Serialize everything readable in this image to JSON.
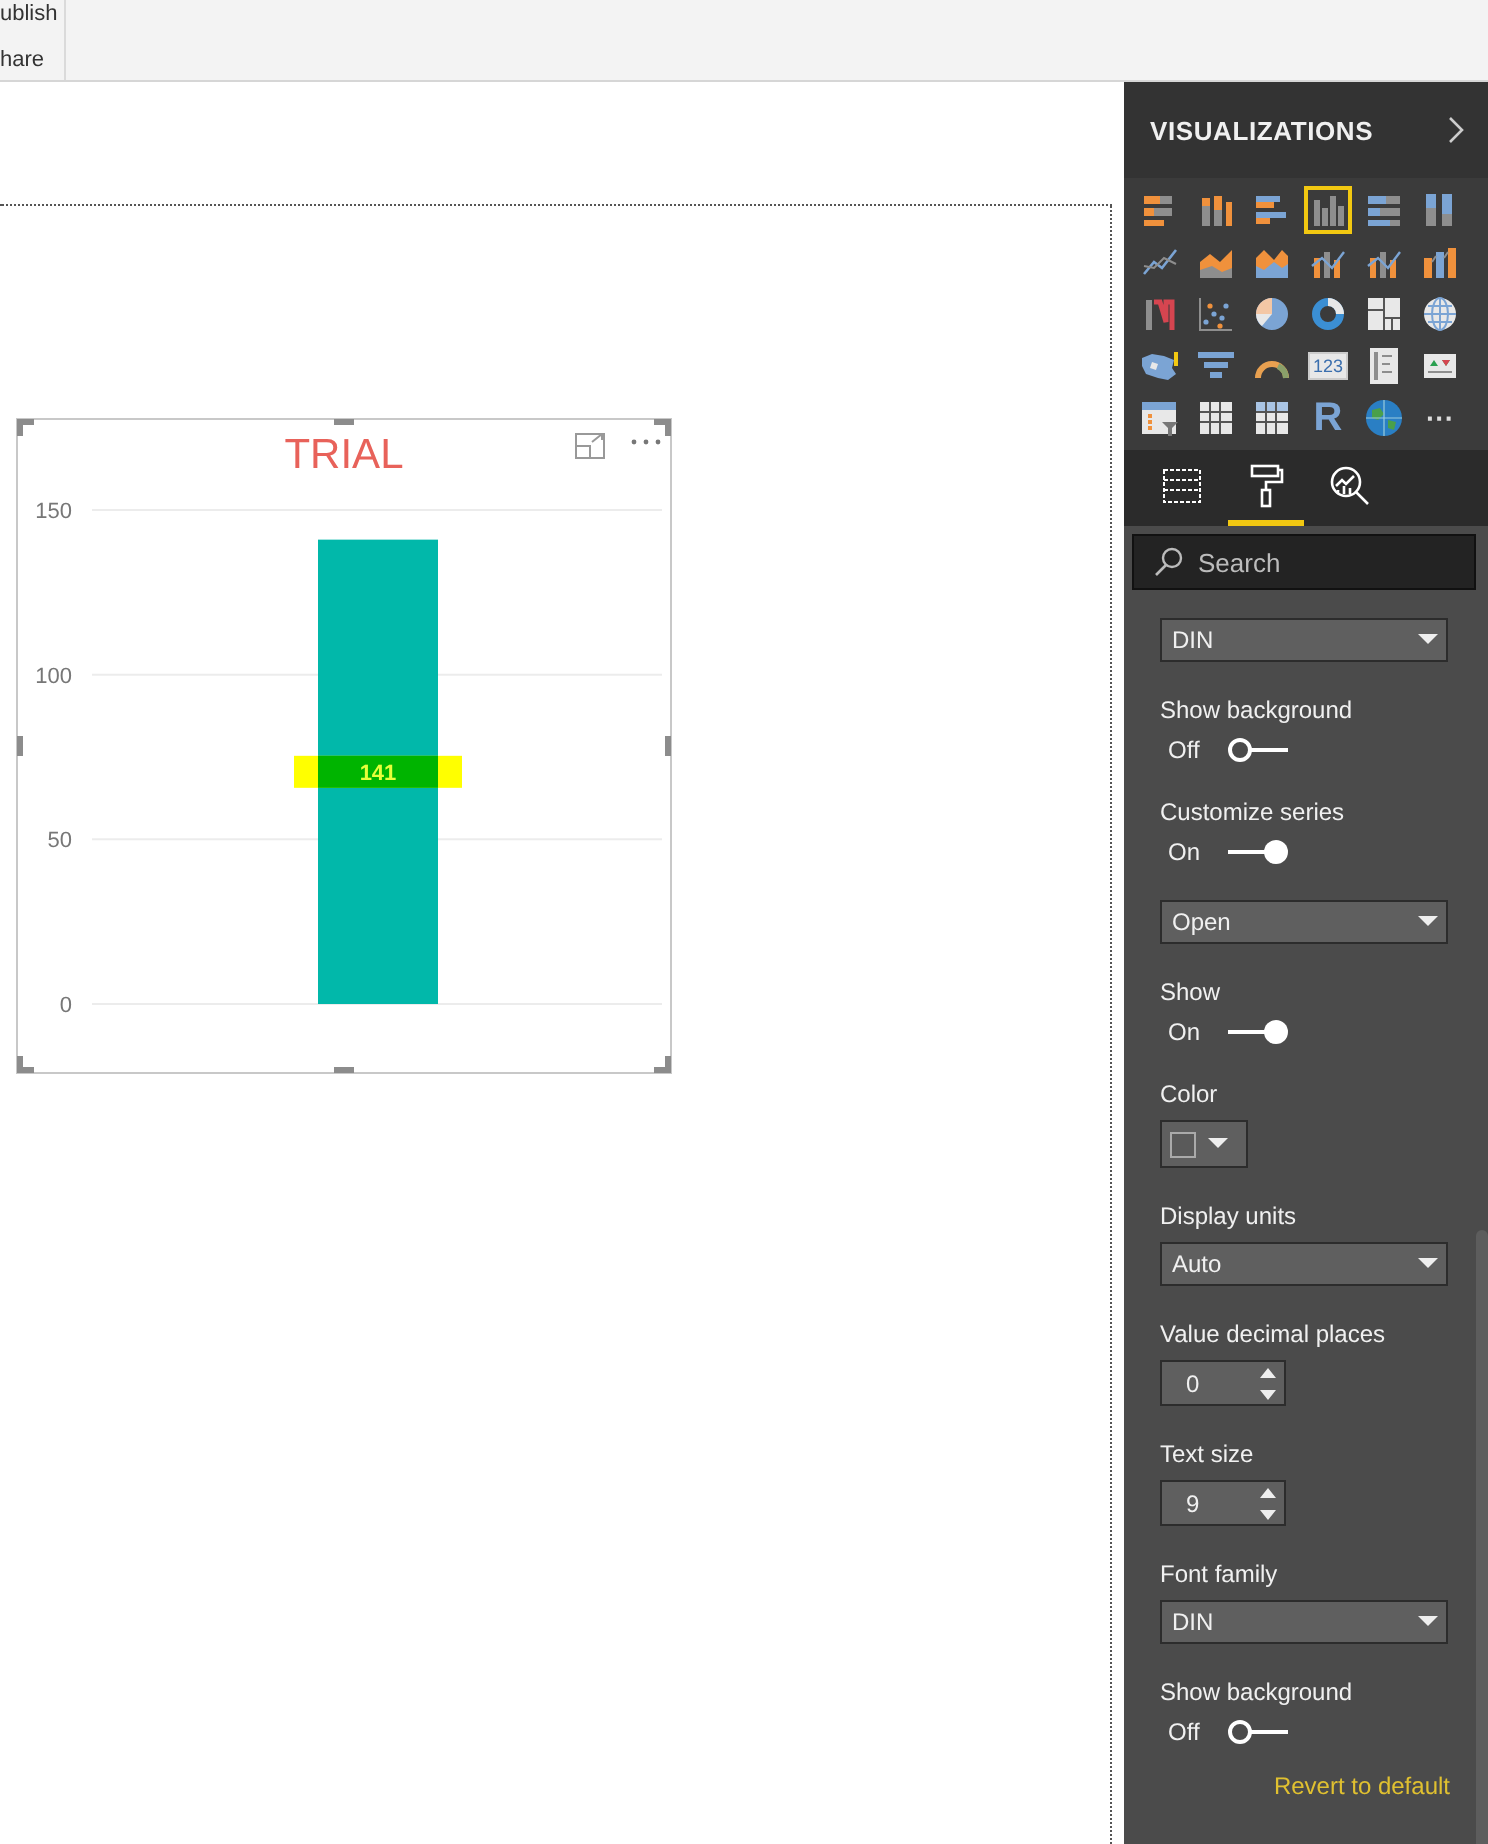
{
  "ribbon": {
    "items": [
      {
        "label": "ublish"
      },
      {
        "label": "hare"
      }
    ]
  },
  "visual": {
    "title": "TRIAL",
    "chart_data": {
      "type": "bar",
      "values": [
        141
      ],
      "ylim": [
        0,
        150
      ],
      "yticks": [
        0,
        50,
        100,
        150
      ],
      "data_labels": true
    }
  },
  "pane": {
    "title": "VISUALIZATIONS",
    "gallery": [
      {
        "kind": "stacked-bar",
        "selected": false
      },
      {
        "kind": "stacked-column",
        "selected": false
      },
      {
        "kind": "clustered-bar",
        "selected": false
      },
      {
        "kind": "clustered-column",
        "selected": true
      },
      {
        "kind": "full-bar",
        "selected": false
      },
      {
        "kind": "full-column",
        "selected": false
      },
      {
        "kind": "line",
        "selected": false
      },
      {
        "kind": "area",
        "selected": false
      },
      {
        "kind": "stacked-area",
        "selected": false
      },
      {
        "kind": "line-column",
        "selected": false
      },
      {
        "kind": "line-column",
        "selected": false
      },
      {
        "kind": "ribbon",
        "selected": false
      },
      {
        "kind": "waterfall",
        "selected": false
      },
      {
        "kind": "scatter",
        "selected": false
      },
      {
        "kind": "pie",
        "selected": false
      },
      {
        "kind": "donut",
        "selected": false
      },
      {
        "kind": "treemap",
        "selected": false
      },
      {
        "kind": "globe",
        "selected": false
      },
      {
        "kind": "map",
        "selected": false
      },
      {
        "kind": "funnel",
        "selected": false
      },
      {
        "kind": "gauge",
        "selected": false
      },
      {
        "kind": "card",
        "selected": false,
        "glyph": "123"
      },
      {
        "kind": "multirow",
        "selected": false
      },
      {
        "kind": "kpi",
        "selected": false
      },
      {
        "kind": "slicer",
        "selected": false
      },
      {
        "kind": "table",
        "selected": false
      },
      {
        "kind": "matrix",
        "selected": false
      },
      {
        "kind": "letter",
        "selected": false,
        "glyph": "R"
      },
      {
        "kind": "earth",
        "selected": false
      },
      {
        "kind": "more",
        "selected": false,
        "glyph": "···"
      }
    ],
    "tabs": [
      {
        "kind": "fields",
        "selected": false
      },
      {
        "kind": "format",
        "selected": true
      },
      {
        "kind": "analytics",
        "selected": false
      }
    ],
    "search": {
      "placeholder": "Search"
    },
    "settings": [
      {
        "kind": "dropdown",
        "value": "DIN"
      },
      {
        "kind": "toggle",
        "label": "Show background",
        "on": false,
        "state_label": "Off"
      },
      {
        "kind": "toggle",
        "label": "Customize series",
        "on": true,
        "state_label": "On"
      },
      {
        "kind": "dropdown",
        "value": "Open"
      },
      {
        "kind": "toggle",
        "label": "Show",
        "on": true,
        "state_label": "On"
      },
      {
        "kind": "color",
        "label": "Color"
      },
      {
        "kind": "dropdown",
        "label": "Display units",
        "value": "Auto"
      },
      {
        "kind": "spinner",
        "label": "Value decimal places",
        "value": "0"
      },
      {
        "kind": "spinner",
        "label": "Text size",
        "value": "9"
      },
      {
        "kind": "dropdown",
        "label": "Font family",
        "value": "DIN"
      },
      {
        "kind": "toggle",
        "label": "Show background",
        "on": false,
        "state_label": "Off"
      },
      {
        "kind": "link",
        "label": "Revert to default"
      }
    ]
  }
}
